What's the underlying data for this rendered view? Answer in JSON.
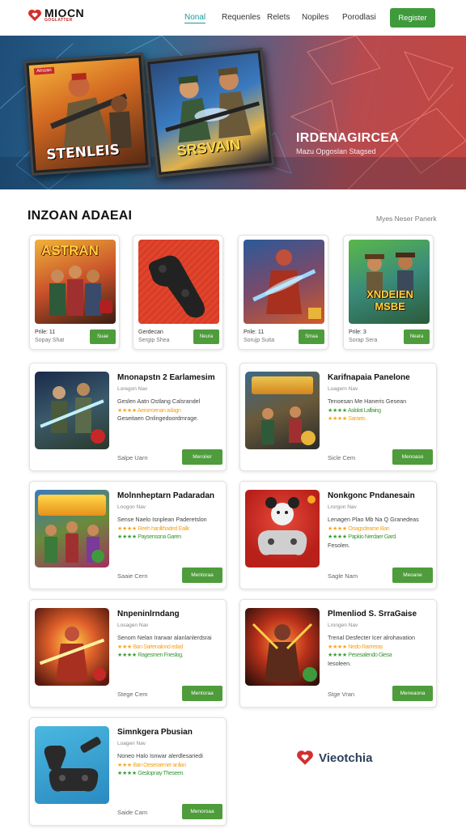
{
  "header": {
    "logo_text": "MIOCN",
    "logo_sub": "GOGLATTER",
    "nav": [
      "Nonal",
      "Requenles",
      "Relets",
      "Nopiles",
      "Porodlasi"
    ],
    "register_label": "Register"
  },
  "hero": {
    "card1_text": "STENLEIS",
    "card1_badge": "Alnoan",
    "card2_text": "SRSVAIN",
    "title": "IRDENAGIRCEA",
    "subtitle": "Mazu Opgoslan Stagsed"
  },
  "section": {
    "title": "INZOAN ADAEAI",
    "link": "Myes Neser Panerk"
  },
  "small_cards": [
    {
      "art": "ASTRAN",
      "line1": "Prile: 11",
      "line2": "Sopay Shat",
      "button": "Suae"
    },
    {
      "art": "",
      "line1": "Gerdecan",
      "line2": "Sergip Shea",
      "button": "Neura"
    },
    {
      "art": "",
      "line1": "Prile: 11",
      "line2": "Sorujp Suita",
      "button": "Smaa"
    },
    {
      "art": "XNDEIEN MSBE",
      "line1": "Prile: 3",
      "line2": "Sorap Sera",
      "button": "Neara"
    }
  ],
  "large_cards": [
    {
      "title": "Mnonapstn 2 Earlamesim",
      "category": "Loregon Nav",
      "desc": [
        "Geslen Aatn Ostlang Calsrandel",
        "★★★★ Aerorroenan adagn",
        "Geseitaen Onlingedoordmrage."
      ],
      "footer": "Salpe Uarn",
      "button": "Meroiler"
    },
    {
      "title": "Karifnapaia Panelone",
      "category": "Loagern Nav",
      "desc": [
        "Tenoesan Me Haneris Gesean",
        "★★★★ Aslolat Lalfaing",
        "★★★★ Saraeis"
      ],
      "footer": "Sicle Cem",
      "button": "Menoaso"
    },
    {
      "title": "Molnnheptarn Padaradan",
      "category": "Lnogon Nav",
      "desc": [
        "Sense Naelo Isnplean Paderetslon",
        "★★★★ Reeh hanllrhaded Eailk",
        "★★★★ Paysensona Garen"
      ],
      "footer": "Saaie Cern",
      "button": "Mentoraa"
    },
    {
      "title": "Nonkgonc Pndanesain",
      "category": "Lrorgon Nav",
      "desc": [
        "Lenagen Plao Mb Na Q Granedeas",
        "★★★★ Onagsdearne Ban",
        "★★★★ Papkio Nerdaer Gard.",
        "Fesolen."
      ],
      "footer": "Sagle Nam",
      "button": "Meoane"
    },
    {
      "title": "Nnpeninlrndang",
      "category": "Losagen Nav",
      "desc": [
        "Senom Nelan Irarwar alanlanlerdsrai",
        "★★★ Ban Sartenalond edad",
        "★★★★ Ragesmen Fneslog."
      ],
      "footer": "Stege Cem",
      "button": "Mentoraa"
    },
    {
      "title": "Plmenliod S. SrraGaise",
      "category": "Lrongen Nav",
      "desc": [
        "Trenal Desfecter Icer alrohavation",
        "★★★★ Nedo Rarrreras",
        "★★★★ Pesesalendo Giesa",
        "Iesoleen."
      ],
      "footer": "Stge Vran",
      "button": "Meneaona"
    },
    {
      "title": "Simnkgera Pbusian",
      "category": "Loagen Nav",
      "desc": [
        "Noneo Halo Isnwar alerdlesariedi",
        "★★★ Ban Oeseraemer anlian",
        "★★★★ Geslopnay Theseen."
      ],
      "footer": "Saide Cam",
      "button": "Menoroaa"
    }
  ],
  "brand": {
    "text": "Vieotchia"
  }
}
